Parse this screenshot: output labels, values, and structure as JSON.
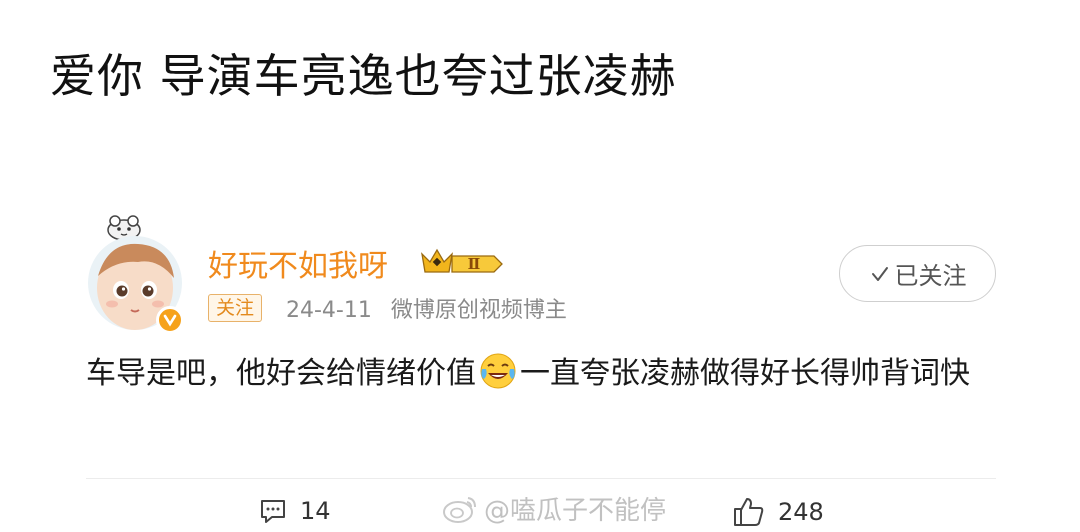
{
  "headline": "爱你 导演车亮逸也夸过张凌赫",
  "post": {
    "username": "好玩不如我呀",
    "vip_badge": "Ⅱ",
    "follow_tag": "关注",
    "date": "24-4-11",
    "source": "微博原创视频博主",
    "followed_button": "已关注",
    "text_part1": "车导是吧，他好会给情绪价值",
    "emoji": "laughing-tears-emoji",
    "text_part2": "一直夸张凌赫做得好长得帅背词快",
    "comments": "14",
    "likes": "248"
  },
  "watermark": "@嗑瓜子不能停",
  "colors": {
    "username": "#f08a1d",
    "verified": "#f6a21b",
    "meta": "#8a8a8a"
  }
}
